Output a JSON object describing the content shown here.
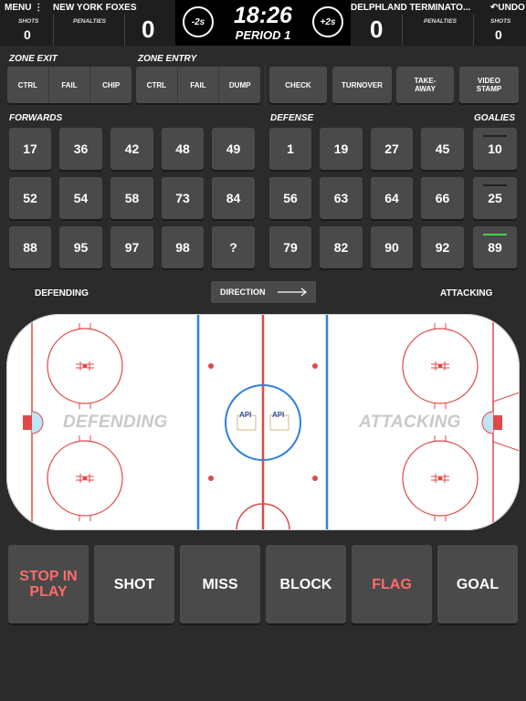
{
  "header": {
    "menu_label": "MENU",
    "home_team": "NEW YORK FOXES",
    "away_team": "DELPHLAND TERMINATO...",
    "undo_label": "UNDO",
    "home_shots_label": "SHOTS",
    "home_shots": "0",
    "home_penalties_label": "PENALTIES",
    "home_score": "0",
    "away_score": "0",
    "away_penalties_label": "PENALTIES",
    "away_shots_label": "SHOTS",
    "away_shots": "0",
    "minus_label": "-2s",
    "plus_label": "+2s",
    "clock": "18:26",
    "period": "PERIOD 1"
  },
  "zone_exit": {
    "label": "ZONE EXIT",
    "options": [
      "CTRL",
      "FAIL",
      "CHIP"
    ]
  },
  "zone_entry": {
    "label": "ZONE ENTRY",
    "options": [
      "CTRL",
      "FAIL",
      "DUMP"
    ]
  },
  "events": {
    "check": "CHECK",
    "turnover": "TURNOVER",
    "takeaway": "TAKE-\nAWAY",
    "video_stamp": "VIDEO\nSTAMP"
  },
  "forwards": {
    "label": "FORWARDS",
    "numbers": [
      "17",
      "36",
      "42",
      "48",
      "49",
      "52",
      "54",
      "58",
      "73",
      "84",
      "88",
      "95",
      "97",
      "98",
      "?"
    ]
  },
  "defense": {
    "label": "DEFENSE",
    "numbers": [
      "1",
      "19",
      "27",
      "45",
      "56",
      "63",
      "64",
      "66",
      "79",
      "82",
      "90",
      "92"
    ]
  },
  "goalies": {
    "label": "GOALIES",
    "numbers": [
      "10",
      "25",
      "89"
    ],
    "active": "89"
  },
  "direction": {
    "label": "DIRECTION",
    "left": "DEFENDING",
    "right": "ATTACKING"
  },
  "rink": {
    "left_zone": "DEFENDING",
    "right_zone": "ATTACKING",
    "logo_text": "API"
  },
  "actions": {
    "stop_in_play": "STOP IN\nPLAY",
    "shot": "SHOT",
    "miss": "MISS",
    "block": "BLOCK",
    "flag": "FLAG",
    "goal": "GOAL"
  },
  "colors": {
    "accent_red": "#ff6b6b",
    "goalie_active": "#3fd34a",
    "rink_red": "#e04848",
    "rink_blue": "#2f7fe0"
  }
}
